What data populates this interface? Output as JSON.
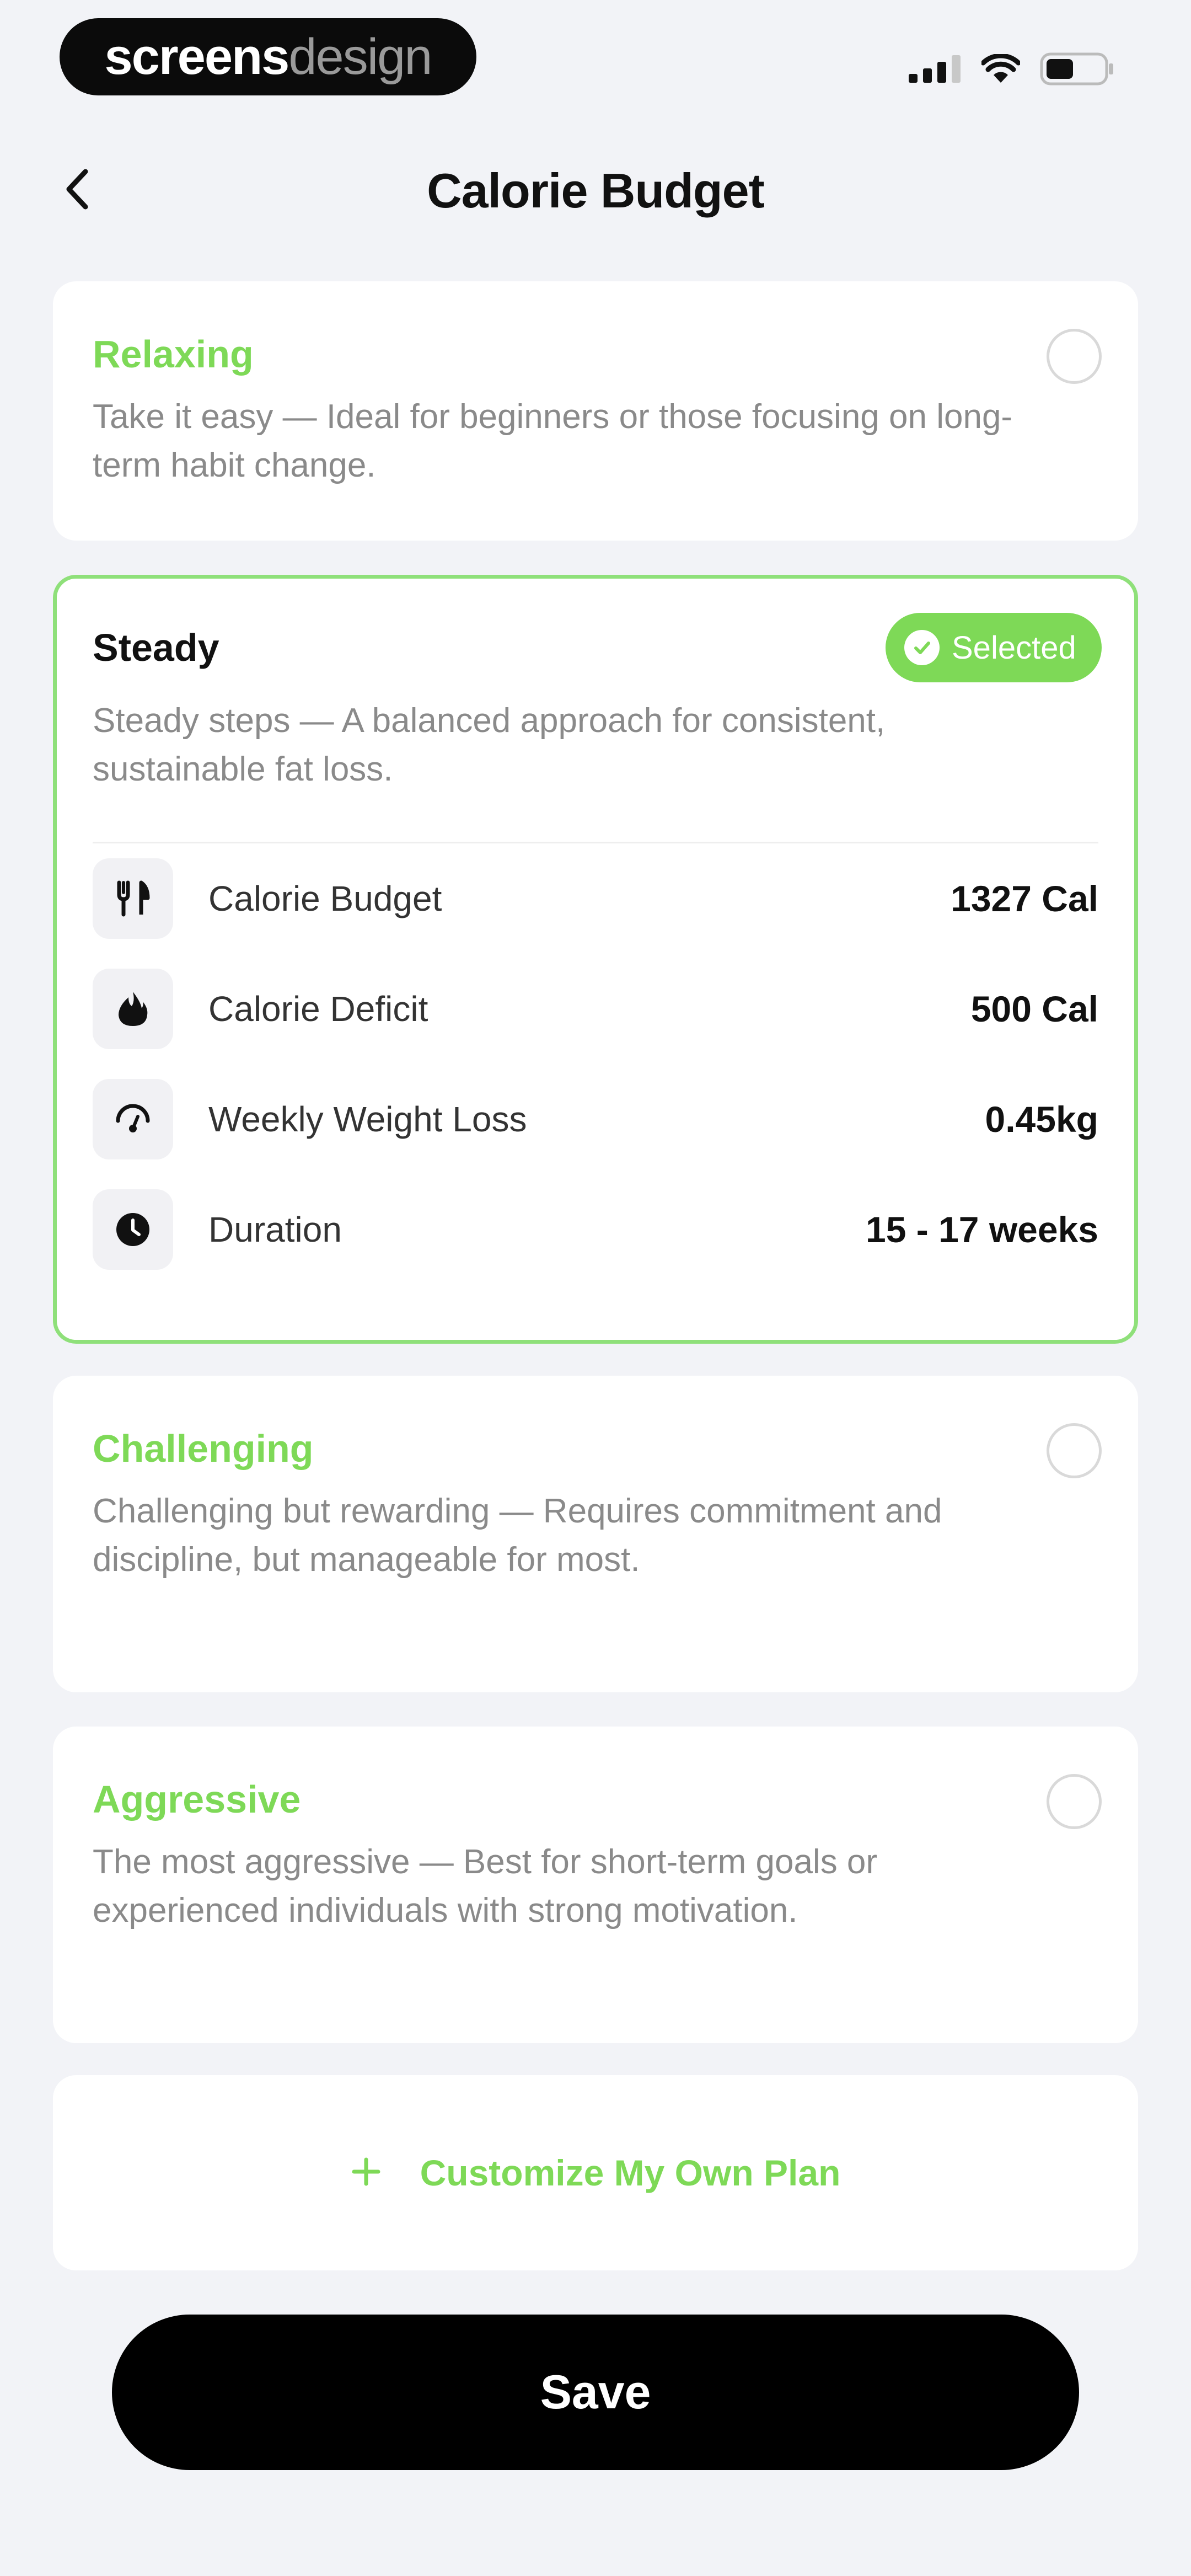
{
  "status_bar": {
    "brand_part1": "screens",
    "brand_part2": "design",
    "icons": [
      "signal-icon",
      "wifi-icon",
      "battery-icon"
    ]
  },
  "header": {
    "back_icon": "chevron-left-icon",
    "title": "Calorie Budget"
  },
  "colors": {
    "accent": "#7ed957",
    "selected_border": "#8fe07a",
    "background": "#f2f3f7",
    "button": "#000000"
  },
  "plans": [
    {
      "title": "Relaxing",
      "description": "Take it easy — Ideal for beginners or those focusing on long-term habit change.",
      "selected": false
    },
    {
      "title": "Steady",
      "description": "Steady steps — A balanced approach for consistent, sustainable fat loss.",
      "selected": true,
      "badge": "Selected",
      "stats": [
        {
          "icon": "utensils-icon",
          "label": "Calorie Budget",
          "value": "1327 Cal"
        },
        {
          "icon": "flame-icon",
          "label": "Calorie Deficit",
          "value": "500 Cal"
        },
        {
          "icon": "gauge-icon",
          "label": "Weekly Weight Loss",
          "value": "0.45kg"
        },
        {
          "icon": "clock-icon",
          "label": "Duration",
          "value": "15 - 17 weeks"
        }
      ]
    },
    {
      "title": "Challenging",
      "description": "Challenging but rewarding — Requires commitment and discipline, but manageable for most.",
      "selected": false
    },
    {
      "title": "Aggressive",
      "description": "The most aggressive — Best for short-term goals or experienced individuals with strong motivation.",
      "selected": false
    }
  ],
  "custom_plan": {
    "icon": "plus-icon",
    "label": "Customize My Own Plan"
  },
  "save_button": {
    "label": "Save"
  }
}
